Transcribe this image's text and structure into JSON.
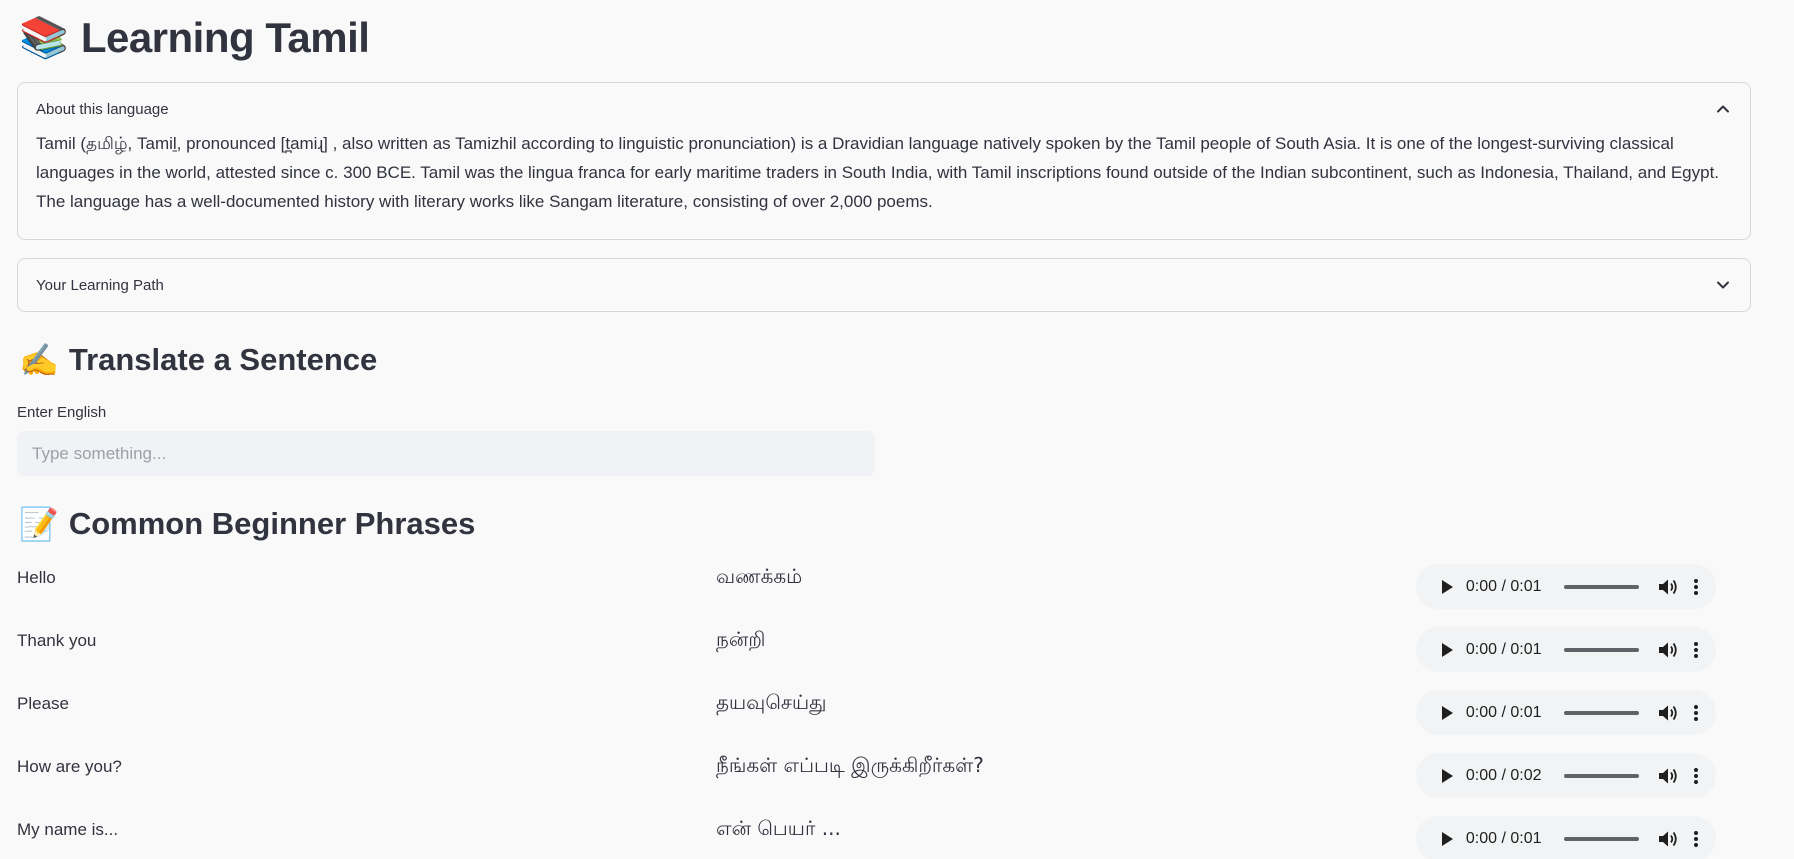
{
  "title": {
    "icon": "books-icon",
    "emoji": "📚",
    "text": "Learning Tamil"
  },
  "about": {
    "label": "About this language",
    "expanded": true,
    "text": "Tamil (தமிழ், Tamiḻ, pronounced [t̪amiɻ] , also written as Tamizhil according to linguistic pronunciation) is a Dravidian language natively spoken by the Tamil people of South Asia. It is one of the longest-surviving classical languages in the world, attested since c. 300 BCE. Tamil was the lingua franca for early maritime traders in South India, with Tamil inscriptions found outside of the Indian subcontinent, such as Indonesia, Thailand, and Egypt. The language has a well-documented history with literary works like Sangam literature, consisting of over 2,000 poems."
  },
  "learning_path": {
    "label": "Your Learning Path",
    "expanded": false
  },
  "translate": {
    "icon": "writing-hand-icon",
    "emoji": "✍️",
    "heading": "Translate a Sentence",
    "input_label": "Enter English",
    "input_value": "",
    "input_placeholder": "Type something..."
  },
  "phrases": {
    "icon": "memo-icon",
    "emoji": "📝",
    "heading": "Common Beginner Phrases",
    "items": [
      {
        "english": "Hello",
        "tamil": "வணக்கம்",
        "audio_time": "0:00 / 0:01",
        "progress": 0
      },
      {
        "english": "Thank you",
        "tamil": "நன்றி",
        "audio_time": "0:00 / 0:01",
        "progress": 0
      },
      {
        "english": "Please",
        "tamil": "தயவுசெய்து",
        "audio_time": "0:00 / 0:01",
        "progress": 0
      },
      {
        "english": "How are you?",
        "tamil": "நீங்கள் எப்படி இருக்கிறீர்கள்?",
        "audio_time": "0:00 / 0:02",
        "progress": 0
      },
      {
        "english": "My name is...",
        "tamil": "என் பெயர் ...",
        "audio_time": "0:00 / 0:01",
        "progress": 0
      }
    ]
  }
}
